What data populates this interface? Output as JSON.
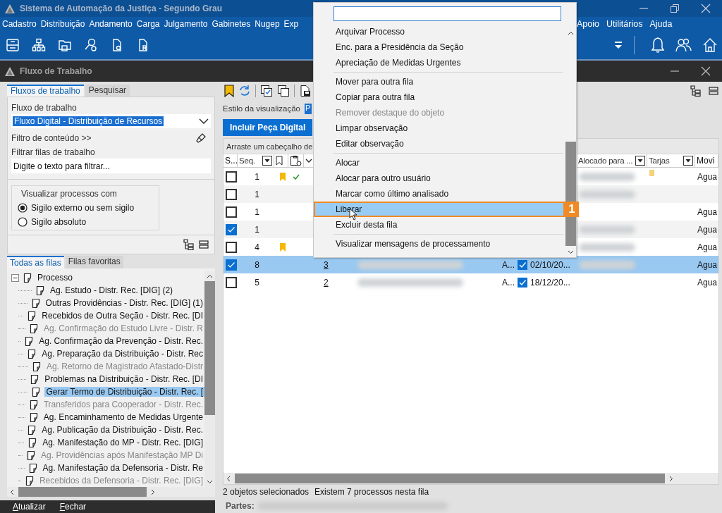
{
  "app": {
    "title": "Sistema de Automação da Justiça - Segundo Grau"
  },
  "menu_bar": {
    "left": [
      "Cadastro",
      "Distribuição",
      "Andamento",
      "Carga",
      "Julgamento",
      "Gabinetes",
      "Nugep",
      "Exp"
    ],
    "right": [
      "Apoio",
      "Utilitários",
      "Ajuda"
    ]
  },
  "workflow_window": {
    "title": "Fluxo de Trabalho"
  },
  "left_tabs": [
    {
      "label": "Fluxos de trabalho",
      "selected": true
    },
    {
      "label": "Pesquisar",
      "selected": false
    }
  ],
  "workflow_field": {
    "label": "Fluxo de trabalho",
    "value": "Fluxo Digital - Distribuição de Recursos"
  },
  "content_filter": "Filtro de conteúdo >>",
  "queue_filter": {
    "label": "Filtrar filas de trabalho",
    "placeholder": "Digite o texto para filtrar..."
  },
  "visibility": {
    "legend": "Visualizar processos com",
    "options": [
      {
        "label": "Sigilo externo ou sem sigilo",
        "selected": true
      },
      {
        "label": "Sigilo absoluto",
        "selected": false
      }
    ]
  },
  "queue_tabs": [
    {
      "label": "Todas as filas",
      "selected": true
    },
    {
      "label": "Filas favoritas",
      "selected": false
    }
  ],
  "tree": {
    "label": "Processo",
    "expanded": true,
    "children": [
      {
        "label": "Ag. Estudo - Distr. Rec. [DIG] (2)",
        "disabled": false,
        "selected": false
      },
      {
        "label": "Outras Providências - Distr. Rec. [DIG] (1)",
        "disabled": false,
        "selected": false
      },
      {
        "label": "Recebidos de Outra Seção - Distr. Rec. [DI",
        "disabled": false,
        "selected": false
      },
      {
        "label": "Ag. Confirmação do Estudo Livre - Distr. R",
        "disabled": true,
        "selected": false
      },
      {
        "label": "Ag. Confirmação da Prevenção - Distr. Rec.",
        "disabled": false,
        "selected": false
      },
      {
        "label": "Ag. Preparação da Distribuição - Distr. Rec",
        "disabled": false,
        "selected": false
      },
      {
        "label": "Ag. Retorno de Magistrado Afastado-Distr",
        "disabled": true,
        "selected": false
      },
      {
        "label": "Problemas na Distribuição - Distr. Rec. [DI",
        "disabled": false,
        "selected": false
      },
      {
        "label": "Gerar Termo de Distribuição - Distr. Rec. [",
        "disabled": false,
        "selected": true
      },
      {
        "label": "Transferidos para Cooperador - Distr. Rec.",
        "disabled": true,
        "selected": false
      },
      {
        "label": "Ag. Encaminhamento de Medidas Urgente",
        "disabled": false,
        "selected": false
      },
      {
        "label": "Ag. Publicação da Distribuição - Distr. Rec.",
        "disabled": false,
        "selected": false
      },
      {
        "label": "Ag. Manifestação do MP - Distr. Rec. [DIG]",
        "disabled": false,
        "selected": false
      },
      {
        "label": "Ag. Providências após Manifestação MP Di",
        "disabled": true,
        "selected": false
      },
      {
        "label": "Ag. Manifestação da Defensoria - Distr. Re",
        "disabled": false,
        "selected": false
      },
      {
        "label": "Recebidos da Defensoria - Distr. Rec. [DIG]",
        "disabled": true,
        "selected": false
      }
    ]
  },
  "footer_buttons": [
    "Atualizar",
    "Fechar"
  ],
  "view_style": {
    "label": "Estilo da visualização",
    "value": "P"
  },
  "action_button": "Incluir Peça Digital",
  "group_hint": "Arraste um cabeçalho de",
  "table": {
    "columns": [
      {
        "kind": "text",
        "label": "S..."
      },
      {
        "kind": "filter",
        "label": "Seq."
      },
      {
        "kind": "bookmark"
      },
      {
        "kind": "attachment"
      },
      {
        "kind": "check"
      },
      {
        "kind": "filter",
        "label": "Alocado para ..."
      },
      {
        "kind": "filter",
        "label": "Tarjas"
      },
      {
        "kind": "text",
        "label": "Movi"
      }
    ],
    "rows": [
      {
        "checked": false,
        "selected": false,
        "seq": "1",
        "bookmark": true,
        "status_ok": true,
        "alocado_redacted": true,
        "tag": true,
        "movement": "Agua"
      },
      {
        "checked": false,
        "selected": false,
        "seq": "1",
        "bookmark": false,
        "status_ok": false,
        "alocado_redacted": true,
        "tag": false
      },
      {
        "checked": false,
        "selected": false,
        "seq": "1",
        "bookmark": false,
        "status_ok": false,
        "alocado_redacted": false,
        "tag": false,
        "movement": "Agua"
      },
      {
        "checked": true,
        "selected": false,
        "seq": "1",
        "bookmark": false,
        "status_ok": false,
        "alocado_redacted": true,
        "tag": false,
        "movement": "Agua"
      },
      {
        "checked": false,
        "selected": false,
        "seq": "4",
        "bookmark": true,
        "status_ok": false,
        "alocado_redacted": true,
        "tag": false,
        "movement": "Agua"
      },
      {
        "checked": true,
        "selected": true,
        "seq": "8",
        "bookmark": false,
        "status_ok": false,
        "link": "3",
        "name_redacted": true,
        "col_a": "A...",
        "flag_checked": true,
        "date": "02/10/20...",
        "alocado_redacted": true,
        "tag": false,
        "movement": "Agua"
      },
      {
        "checked": false,
        "selected": false,
        "seq": "5",
        "bookmark": false,
        "status_ok": false,
        "link": "2",
        "name_redacted": true,
        "col_a": "A...",
        "flag_checked": true,
        "date": "18/12/20...",
        "alocado_redacted": false,
        "tag": false,
        "movement": "Agua"
      }
    ]
  },
  "status_bar": {
    "selection": "2 objetos selecionados",
    "count": "Existem 7 processos nesta fila"
  },
  "parts_label": "Partes:",
  "context_menu": {
    "groups": [
      [
        {
          "label": "Arquivar Processo",
          "disabled": false,
          "selected": false
        },
        {
          "label": "Enc. para a Presidência da Seção",
          "disabled": false,
          "selected": false
        },
        {
          "label": "Apreciação de Medidas Urgentes",
          "disabled": false,
          "selected": false
        }
      ],
      [
        {
          "label": "Mover para outra fila",
          "disabled": false,
          "selected": false
        },
        {
          "label": "Copiar para outra fila",
          "disabled": false,
          "selected": false
        },
        {
          "label": "Remover destaque do objeto",
          "disabled": true,
          "selected": false
        },
        {
          "label": "Limpar observação",
          "disabled": false,
          "selected": false
        },
        {
          "label": "Editar observação",
          "disabled": false,
          "selected": false
        }
      ],
      [
        {
          "label": "Alocar",
          "disabled": false,
          "selected": false
        },
        {
          "label": "Alocar para outro usuário",
          "disabled": false,
          "selected": false
        },
        {
          "label": "Marcar como último analisado",
          "disabled": false,
          "selected": false
        },
        {
          "label": "Liberar",
          "disabled": false,
          "selected": true
        },
        {
          "label": "Excluir desta fila",
          "disabled": false,
          "selected": false
        }
      ],
      [
        {
          "label": "Visualizar mensagens de processamento",
          "disabled": false,
          "selected": false
        }
      ]
    ]
  },
  "callout": "1"
}
